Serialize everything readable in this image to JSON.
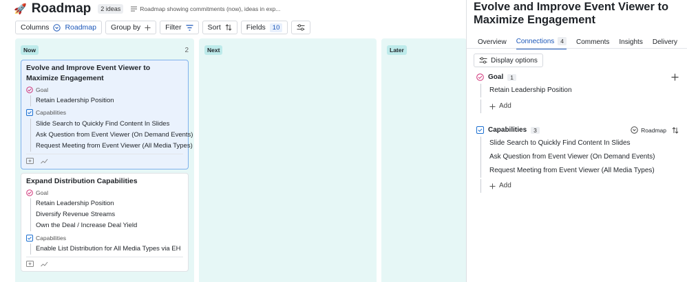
{
  "header": {
    "title": "Roadmap",
    "ideas_badge": "2 ideas",
    "description": "Roadmap showing commitments (now), ideas in exp..."
  },
  "toolbar": {
    "columns_label": "Columns",
    "columns_value": "Roadmap",
    "group_by_label": "Group by",
    "filter_label": "Filter",
    "sort_label": "Sort",
    "fields_label": "Fields",
    "fields_count": "10"
  },
  "board": {
    "columns": [
      {
        "name": "Now",
        "count": "2"
      },
      {
        "name": "Next",
        "count": ""
      },
      {
        "name": "Later",
        "count": ""
      }
    ],
    "cards": [
      {
        "title": "Evolve and Improve Event Viewer to Maximize Engagement",
        "goal_label": "Goal",
        "goals": [
          "Retain Leadership Position"
        ],
        "capabilities_label": "Capabilities",
        "capabilities": [
          "Slide Search to Quickly Find Content In Slides",
          "Ask Question from Event Viewer (On Demand Events)",
          "Request Meeting from Event Viewer (All Media Types)"
        ]
      },
      {
        "title": "Expand Distribution Capabilities",
        "goal_label": "Goal",
        "goals": [
          "Retain Leadership Position",
          "Diversify Revenue Streams",
          "Own the Deal / Increase Deal Yield"
        ],
        "capabilities_label": "Capabilities",
        "capabilities": [
          "Enable List Distribution for All Media Types via EH"
        ]
      }
    ]
  },
  "panel": {
    "title": "Evolve and Improve Event Viewer to Maximize Engagement",
    "tabs": [
      {
        "label": "Overview",
        "count": ""
      },
      {
        "label": "Connections",
        "count": "4"
      },
      {
        "label": "Comments",
        "count": ""
      },
      {
        "label": "Insights",
        "count": ""
      },
      {
        "label": "Delivery",
        "count": ""
      }
    ],
    "display_options": "Display options",
    "goal_section": {
      "label": "Goal",
      "count": "1",
      "items": [
        "Retain Leadership Position"
      ],
      "add_label": "Add"
    },
    "capabilities_section": {
      "label": "Capabilities",
      "count": "3",
      "sort_label": "Roadmap",
      "items": [
        "Slide Search to Quickly Find Content In Slides",
        "Ask Question from Event Viewer (On Demand Events)",
        "Request Meeting from Event Viewer (All Media Types)"
      ],
      "add_label": "Add"
    }
  },
  "colors": {
    "accent": "#1a56b8",
    "column_bg": "#e6f7f6",
    "column_tag": "#bdeaea",
    "goal": "#d0357a",
    "capability": "#1a6fd1"
  }
}
